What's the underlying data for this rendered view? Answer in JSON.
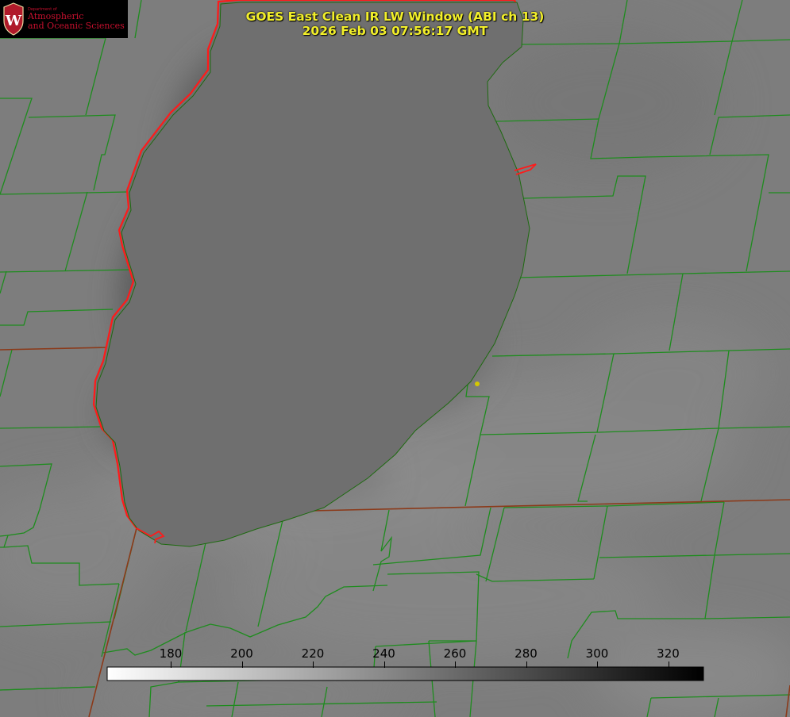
{
  "title": {
    "line1": "GOES East Clean IR LW Window (ABI ch 13)",
    "line2": "2026 Feb 03 07:56:17 GMT"
  },
  "logo": {
    "dept": "Department of",
    "line1": "Atmospheric",
    "line2": "and Oceanic Sciences",
    "seal_letter": "W"
  },
  "colorbar": {
    "ticks": [
      "180",
      "200",
      "220",
      "240",
      "260",
      "280",
      "300",
      "320"
    ],
    "scale_from_color": "#ffffff",
    "scale_to_color": "#000000"
  },
  "colors": {
    "county_lines": "#1e8c1e",
    "state_lines": "#8b3a1a",
    "lake_outline": "#ff1a1a",
    "title_text": "#f2ef2a",
    "marker": "#d4c800",
    "logo_red": "#c8102e"
  }
}
